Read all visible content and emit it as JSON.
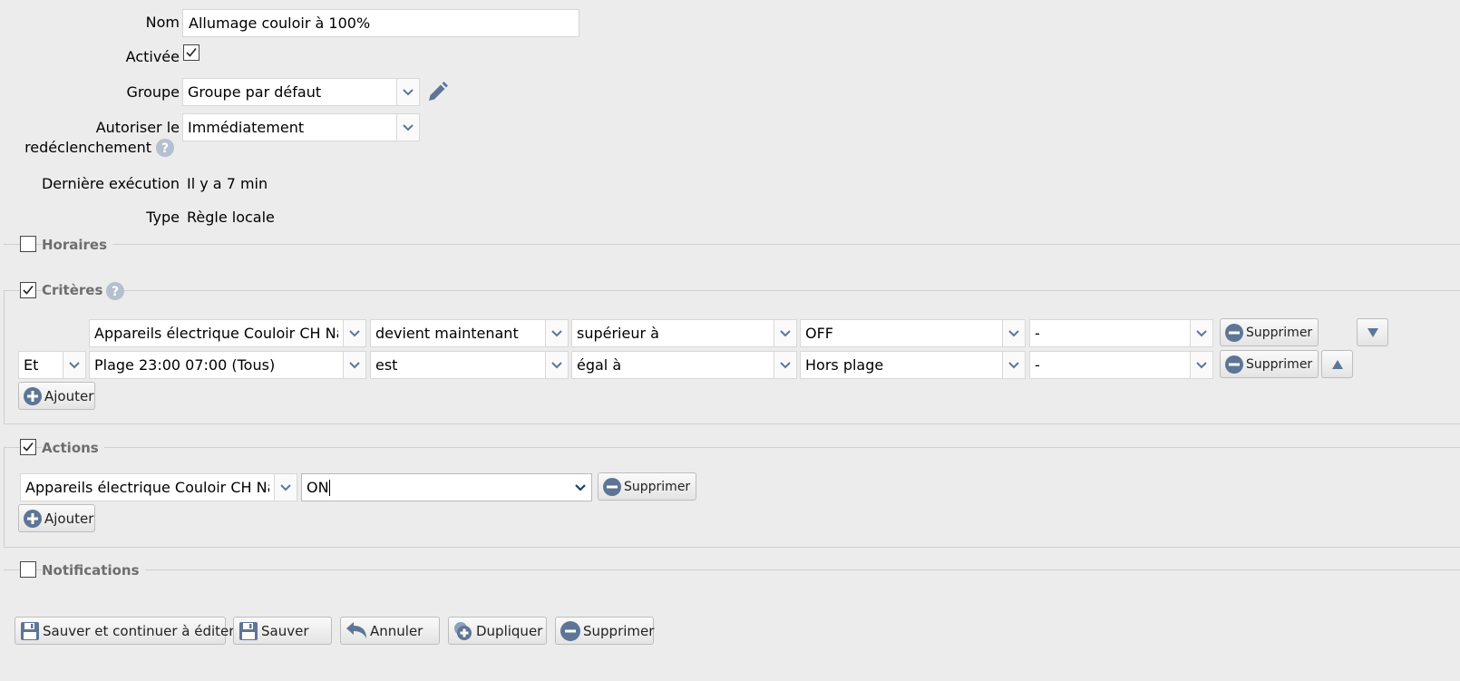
{
  "form": {
    "name_label": "Nom",
    "name_value": "Allumage couloir à 100%",
    "enabled_label": "Activée",
    "enabled_checked": true,
    "group_label": "Groupe",
    "group_value": "Groupe par défaut",
    "retrigger_label_line1": "Autoriser le",
    "retrigger_label_line2": "redéclenchement",
    "retrigger_value": "Immédiatement",
    "last_exec_label": "Dernière exécution",
    "last_exec_value": "Il y a 7 min",
    "type_label": "Type",
    "type_value": "Règle locale"
  },
  "sections": {
    "horaires": {
      "title": "Horaires",
      "checked": false
    },
    "criteres": {
      "title": "Critères",
      "checked": true
    },
    "actions": {
      "title": "Actions",
      "checked": true
    },
    "notifications": {
      "title": "Notifications",
      "checked": false
    }
  },
  "criteria": {
    "rows": [
      {
        "conjunction": "",
        "device": "Appareils électrique Couloir CH Nat",
        "event": "devient maintenant",
        "operator": "supérieur à",
        "value": "OFF",
        "extra": "-"
      },
      {
        "conjunction": "Et",
        "device": "Plage 23:00 07:00 (Tous)",
        "event": "est",
        "operator": "égal à",
        "value": "Hors plage",
        "extra": "-"
      }
    ],
    "delete_label": "Supprimer",
    "add_label": "Ajouter"
  },
  "actions": {
    "rows": [
      {
        "device": "Appareils électrique Couloir CH Nat",
        "value": "ON"
      }
    ],
    "delete_label": "Supprimer",
    "add_label": "Ajouter"
  },
  "footer": {
    "save_continue": "Sauver et continuer à éditer",
    "save": "Sauver",
    "cancel": "Annuler",
    "duplicate": "Dupliquer",
    "delete": "Supprimer"
  },
  "colors": {
    "background": "#ececec",
    "icon_blue": "#5d7596",
    "section_title": "#6e6e6e"
  }
}
